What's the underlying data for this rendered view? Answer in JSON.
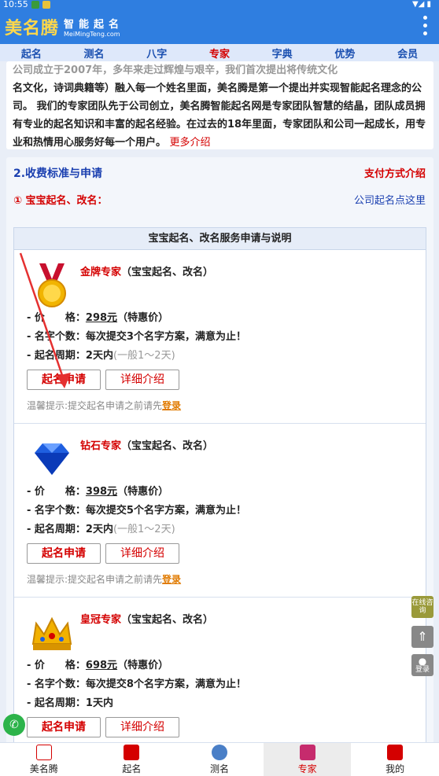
{
  "status": {
    "time": "10:55"
  },
  "header": {
    "logo": "美名腾",
    "slogan": "智能起名",
    "domain": "MeiMingTeng.com"
  },
  "nav": {
    "items": [
      "起名",
      "测名",
      "八字",
      "专家",
      "字典",
      "优势",
      "会员"
    ],
    "active_index": 3
  },
  "intro": {
    "faded_line": "公司成立于2007年，多年来走过辉煌与艰辛，我们首次提出将传统文化",
    "text": "名文化，诗词典籍等）融入每一个姓名里面，美名腾是第一个提出并实现智能起名理念的公司。 我们的专家团队先于公司创立，美名腾智能起名网是专家团队智慧的结晶，团队成员拥有专业的起名知识和丰富的起名经验。在过去的18年里面，专家团队和公司一起成长，用专业和热情用心服务好每一个用户。",
    "more": "更多介绍"
  },
  "section": {
    "title": "2.收费标准与申请",
    "pay_link": "支付方式介绍",
    "subtitle": "① 宝宝起名、改名：",
    "corp_link": "公司起名点这里",
    "card_header": "宝宝起名、改名服务申请与说明"
  },
  "plans": [
    {
      "name": "金牌专家",
      "scope": "（宝宝起名、改名）",
      "price_label": "- 价　　格：",
      "price": "298元",
      "price_note": "（特惠价）",
      "count_label": "- 名字个数：",
      "count": "每次提交3个名字方案，满意为止！",
      "period_label": "- 起名周期：",
      "period": "2天内",
      "period_note": "(一般1～2天)",
      "apply": "起名申请",
      "detail": "详细介绍",
      "tip": "温馨提示:提交起名申请之前请先",
      "login": "登录"
    },
    {
      "name": "钻石专家",
      "scope": "（宝宝起名、改名）",
      "price_label": "- 价　　格：",
      "price": "398元",
      "price_note": "（特惠价）",
      "count_label": "- 名字个数：",
      "count": "每次提交5个名字方案，满意为止！",
      "period_label": "- 起名周期：",
      "period": "2天内",
      "period_note": "(一般1～2天)",
      "apply": "起名申请",
      "detail": "详细介绍",
      "tip": "温馨提示:提交起名申请之前请先",
      "login": "登录"
    },
    {
      "name": "皇冠专家",
      "scope": "（宝宝起名、改名）",
      "price_label": "- 价　　格：",
      "price": "698元",
      "price_note": "（特惠价）",
      "count_label": "- 名字个数：",
      "count": "每次提交8个名字方案，满意为止！",
      "period_label": "- 起名周期：",
      "period": "1天内",
      "period_note": "",
      "apply": "起名申请",
      "detail": "详细介绍",
      "tip": "",
      "login": ""
    }
  ],
  "side": {
    "online": "在线咨询",
    "login": "登录"
  },
  "tabbar": {
    "items": [
      "美名腾",
      "起名",
      "测名",
      "专家",
      "我的"
    ],
    "active_index": 3
  },
  "colors": {
    "brand": "#2f7ee0",
    "accent": "#d40000",
    "link": "#1a3fb0"
  }
}
